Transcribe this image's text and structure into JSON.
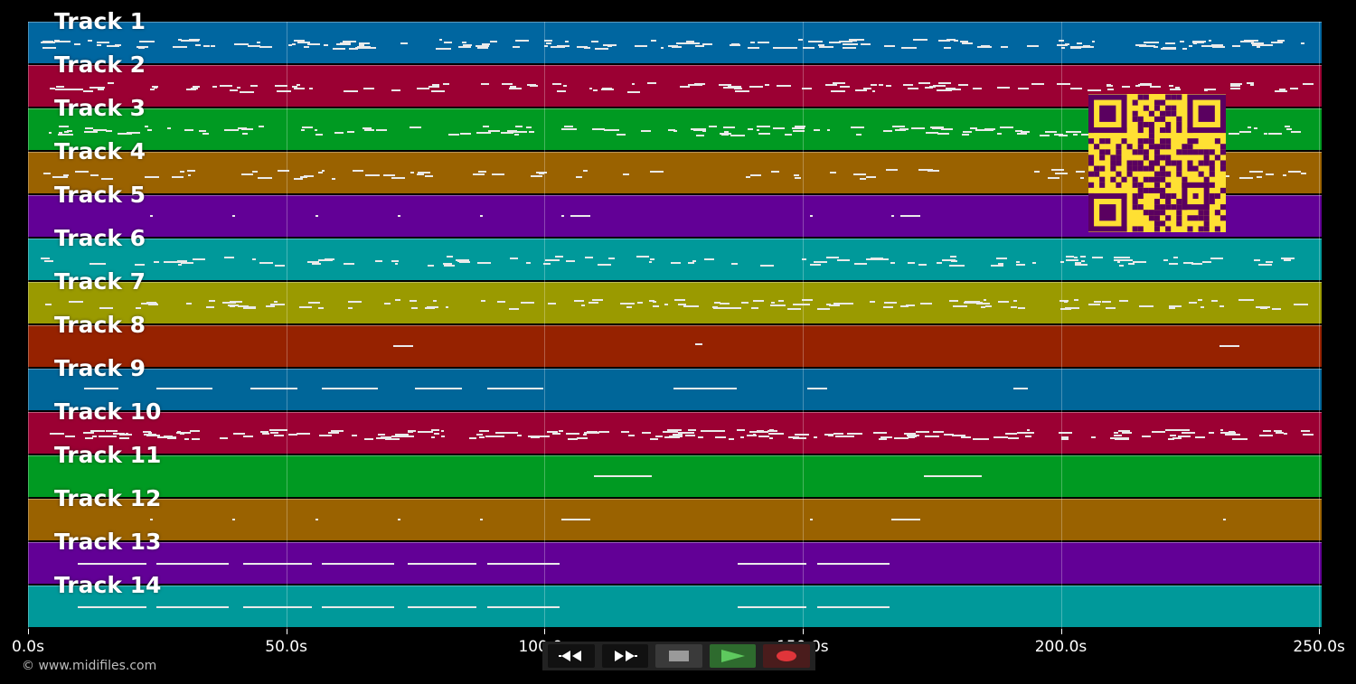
{
  "tracks": [
    {
      "label": "Track 1",
      "color": "#0066a0"
    },
    {
      "label": "Track 2",
      "color": "#9b0033"
    },
    {
      "label": "Track 3",
      "color": "#009a22"
    },
    {
      "label": "Track 4",
      "color": "#9a6200"
    },
    {
      "label": "Track 5",
      "color": "#620096"
    },
    {
      "label": "Track 6",
      "color": "#00999a"
    },
    {
      "label": "Track 7",
      "color": "#9a9a00"
    },
    {
      "label": "Track 8",
      "color": "#962200"
    },
    {
      "label": "Track 9",
      "color": "#006699"
    },
    {
      "label": "Track 10",
      "color": "#9b0033"
    },
    {
      "label": "Track 11",
      "color": "#009a22"
    },
    {
      "label": "Track 12",
      "color": "#9a6200"
    },
    {
      "label": "Track 13",
      "color": "#620096"
    },
    {
      "label": "Track 14",
      "color": "#00999a"
    }
  ],
  "timeline": {
    "ticks": [
      "0.0s",
      "50.0s",
      "100.0s",
      "150.0s",
      "200.0s",
      "250.0s"
    ],
    "tick_values": [
      0,
      50,
      100,
      150,
      200,
      250
    ],
    "duration_s": 250.5
  },
  "copyright": "© www.midifiles.com",
  "transport": {
    "rewind_icon": "rewind-icon",
    "fast_forward_icon": "fast-forward-icon",
    "stop_icon": "stop-icon",
    "play_icon": "play-icon",
    "record_icon": "record-icon"
  },
  "qr_code": {
    "color_fg": "#5a0060",
    "color_bg": "#ffe033"
  }
}
